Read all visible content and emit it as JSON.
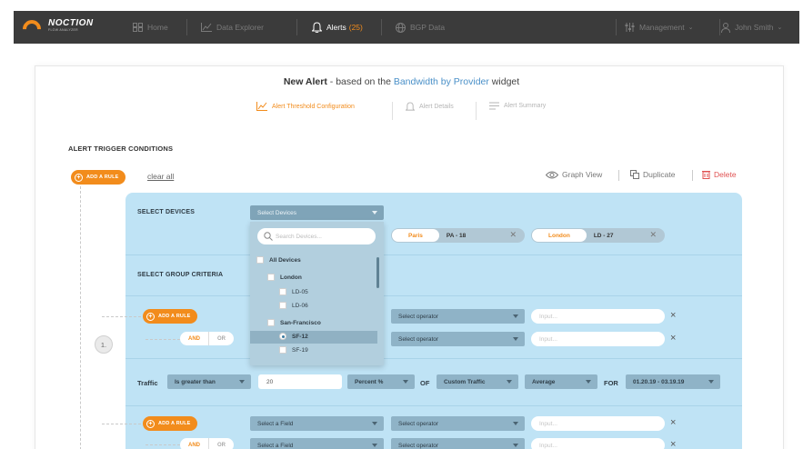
{
  "nav": {
    "logo_line1": "NOCTION",
    "logo_line2": "FLOW ANALYZER",
    "home": "Home",
    "data_explorer": "Data Explorer",
    "alerts": "Alerts",
    "alerts_count": "(25)",
    "bgp_data": "BGP Data",
    "management": "Management",
    "user": "John Smith"
  },
  "header": {
    "title_bold": "New Alert",
    "title_mid": " - based on the ",
    "title_link": "Bandwidth by Provider",
    "title_end": " widget",
    "steps": [
      "Alert Threshold Configuration",
      "Alert Details",
      "Alert Summary"
    ]
  },
  "section": {
    "title": "ALERT TRIGGER CONDITIONS",
    "add_rule": "ADD A RULE",
    "clear_all": "clear all",
    "graph_view": "Graph View",
    "duplicate": "Duplicate",
    "delete": "Delete"
  },
  "rule": {
    "number": "1.",
    "select_devices_label": "SELECT DEVICES",
    "select_devices_placeholder": "Select Devices",
    "group_criteria_label": "SELECT GROUP CRITERIA",
    "tags": [
      {
        "city": "Paris",
        "code": "PA - 18"
      },
      {
        "city": "London",
        "code": "LD - 27"
      }
    ],
    "add_rule": "ADD A RULE",
    "and": "AND",
    "or": "OR",
    "select_operator": "Select operator",
    "input_placeholder": "Input...",
    "select_field": "Select a Field",
    "close": "×",
    "traffic": {
      "label": "Traffic",
      "condition": "Is greater than",
      "value": "20",
      "unit": "Percent %",
      "of": "OF",
      "traffic_type": "Custom Traffic",
      "aggregation": "Average",
      "for": "FOR",
      "period": "01.20.19 - 03.19.19"
    }
  },
  "dropdown": {
    "search_placeholder": "Search Devices...",
    "all_devices": "All Devices",
    "london": "London",
    "ld05": "LD-05",
    "ld06": "LD-06",
    "sf": "San-Francisco",
    "sf12": "SF-12",
    "sf19": "SF-19"
  },
  "colors": {
    "accent": "#f28c1c",
    "topbar": "#3b3b3b",
    "rule_bg": "#bfe3f5",
    "link": "#4a90c8",
    "delete": "#e05252"
  }
}
